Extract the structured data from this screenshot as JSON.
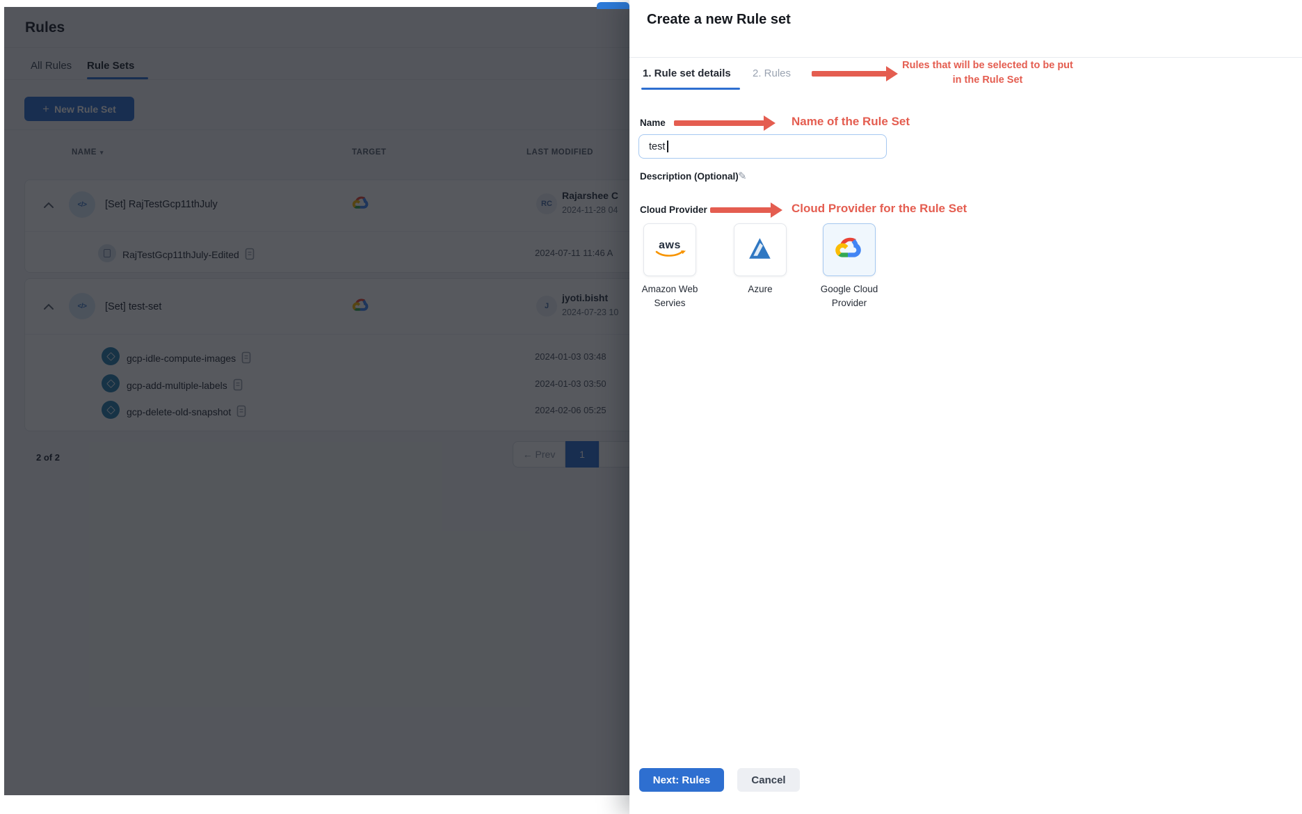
{
  "icons": {
    "plus": "+",
    "sort_caret": "▾",
    "pencil": "✎",
    "ruleset_glyph": "</>"
  },
  "colors": {
    "accent_blue": "#2e6fd0",
    "annotation_red": "#e45d50"
  },
  "page": {
    "title": "Rules",
    "tabs": [
      {
        "label": "All Rules"
      },
      {
        "label": "Rule Sets"
      }
    ],
    "new_rule_set_button": "New Rule Set",
    "table": {
      "headers": {
        "name": "NAME",
        "target": "TARGET",
        "last_modified": "LAST MODIFIED"
      },
      "groups": [
        {
          "name": "[Set] RajTestGcp11thJuly",
          "target": "google-cloud",
          "avatar": "RC",
          "modified_by": "Rajarshee C",
          "modified_at": "2024-11-28 04",
          "rules": [
            {
              "name": "RajTestGcp11thJuly-Edited",
              "modified_at": "2024-07-11 11:46 A"
            }
          ]
        },
        {
          "name": "[Set] test-set",
          "target": "google-cloud",
          "avatar": "J",
          "modified_by": "jyoti.bisht",
          "modified_at": "2024-07-23 10",
          "rules": [
            {
              "name": "gcp-idle-compute-images",
              "modified_at": "2024-01-03 03:48"
            },
            {
              "name": "gcp-add-multiple-labels",
              "modified_at": "2024-01-03 03:50"
            },
            {
              "name": "gcp-delete-old-snapshot",
              "modified_at": "2024-02-06 05:25"
            }
          ]
        }
      ]
    },
    "pagination": {
      "summary": "2 of 2",
      "prev": "← Prev",
      "page": "1"
    }
  },
  "drawer": {
    "title": "Create a new Rule set",
    "steps": [
      {
        "label": "1. Rule set details"
      },
      {
        "label": "2. Rules"
      }
    ],
    "annotations": {
      "rules_note_line1": "Rules that will be selected to be put",
      "rules_note_line2": "in the Rule Set",
      "name_note": "Name of the Rule Set",
      "provider_note": "Cloud Provider for the Rule Set"
    },
    "form": {
      "name_label": "Name",
      "name_value": "test",
      "description_label": "Description (Optional)",
      "provider_label": "Cloud Provider",
      "providers": [
        {
          "name": "Amazon Web Servies"
        },
        {
          "name": "Azure"
        },
        {
          "name": "Google Cloud Provider"
        }
      ]
    },
    "footer": {
      "next": "Next: Rules",
      "cancel": "Cancel"
    }
  }
}
